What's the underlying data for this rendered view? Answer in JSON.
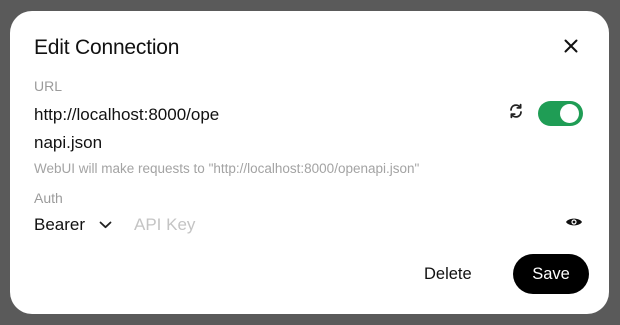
{
  "dialog": {
    "title": "Edit Connection",
    "close_icon": "close-icon"
  },
  "url_field": {
    "label": "URL",
    "value": "http://localhost:8000/openapi.json",
    "helper": "WebUI will make requests to \"http://localhost:8000/openapi.json\"",
    "refresh_icon": "refresh-icon",
    "enabled": true,
    "toggle_color": "#1f9d55"
  },
  "auth": {
    "label": "Auth",
    "type": "Bearer",
    "chevron_icon": "chevron-down-icon",
    "api_key_placeholder": "API Key",
    "api_key_value": "",
    "eye_icon": "eye-icon"
  },
  "actions": {
    "delete_label": "Delete",
    "save_label": "Save",
    "save_bg": "#000000"
  }
}
